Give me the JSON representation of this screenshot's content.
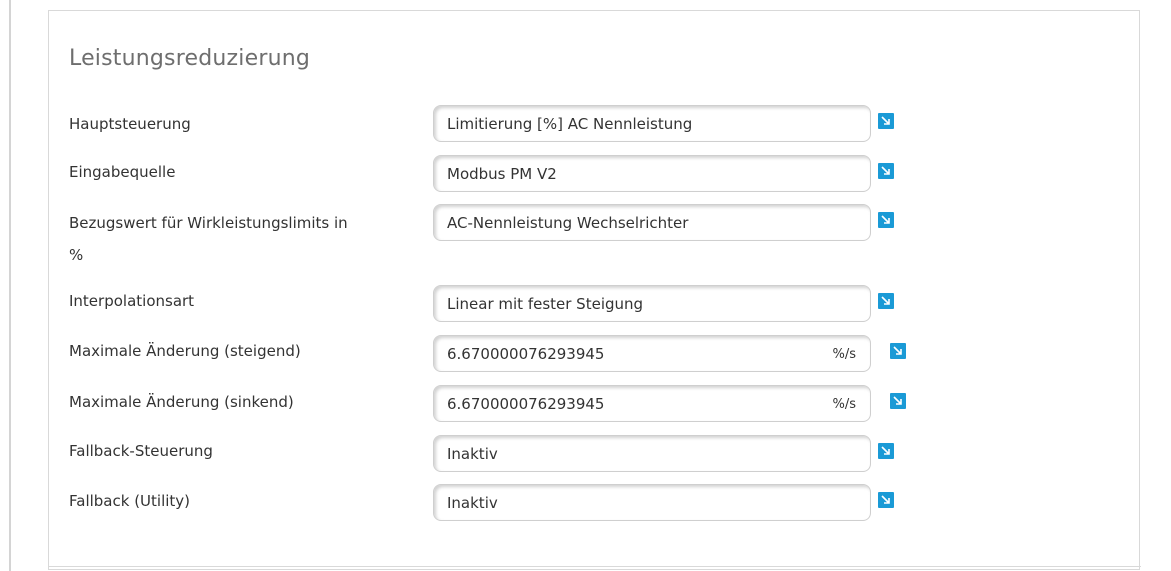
{
  "section": {
    "title": "Leistungsreduzierung"
  },
  "rows": [
    {
      "label": "Hauptsteuerung",
      "value": "Limitierung [%] AC Nennleistung",
      "unit": ""
    },
    {
      "label": "Eingabequelle",
      "value": "Modbus PM V2",
      "unit": ""
    },
    {
      "label": "Bezugswert für Wirkleistungslimits in",
      "label2": "%",
      "value": "AC-Nennleistung Wechselrichter",
      "unit": ""
    },
    {
      "label": "Interpolationsart",
      "value": "Linear mit fester Steigung",
      "unit": ""
    },
    {
      "label": "Maximale Änderung (steigend)",
      "value": "6.670000076293945",
      "unit": "%/s"
    },
    {
      "label": "Maximale Änderung (sinkend)",
      "value": "6.670000076293945",
      "unit": "%/s"
    },
    {
      "label": "Fallback-Steuerung",
      "value": "Inaktiv",
      "unit": ""
    },
    {
      "label": "Fallback (Utility)",
      "value": "Inaktiv",
      "unit": ""
    }
  ],
  "icons": {
    "info_button": "arrow-down-right-icon"
  },
  "colors": {
    "accent": "#1a9ad6",
    "title": "#6e6e6e",
    "text": "#333333",
    "border": "#d9d9d9"
  }
}
